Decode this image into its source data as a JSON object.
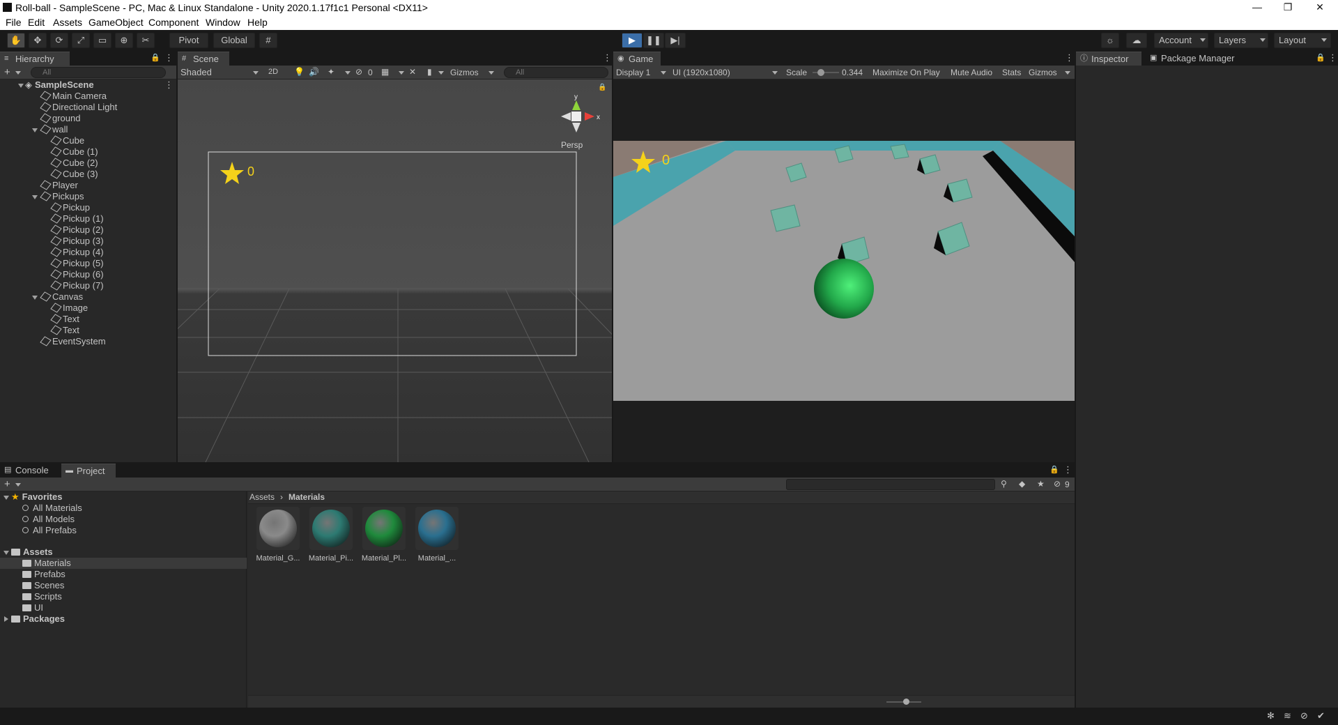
{
  "window": {
    "title": "Roll-ball - SampleScene - PC, Mac & Linux Standalone - Unity 2020.1.17f1c1 Personal <DX11>",
    "minimize": "—",
    "maximize": "❐",
    "close": "✕"
  },
  "menu": [
    "File",
    "Edit",
    "Assets",
    "GameObject",
    "Component",
    "Window",
    "Help"
  ],
  "toolbar": {
    "pivot": "Pivot",
    "global": "Global",
    "account": "Account",
    "layers": "Layers",
    "layout": "Layout"
  },
  "hierarchy": {
    "tab": "Hierarchy",
    "search_placeholder": "All",
    "scene": "SampleScene",
    "items": [
      {
        "label": "Main Camera",
        "level": 1
      },
      {
        "label": "Directional Light",
        "level": 1
      },
      {
        "label": "ground",
        "level": 1
      },
      {
        "label": "wall",
        "level": 1,
        "expanded": true
      },
      {
        "label": "Cube",
        "level": 2
      },
      {
        "label": "Cube (1)",
        "level": 2
      },
      {
        "label": "Cube (2)",
        "level": 2
      },
      {
        "label": "Cube (3)",
        "level": 2
      },
      {
        "label": "Player",
        "level": 1
      },
      {
        "label": "Pickups",
        "level": 1,
        "expanded": true
      },
      {
        "label": "Pickup",
        "level": 2
      },
      {
        "label": "Pickup (1)",
        "level": 2
      },
      {
        "label": "Pickup (2)",
        "level": 2
      },
      {
        "label": "Pickup (3)",
        "level": 2
      },
      {
        "label": "Pickup (4)",
        "level": 2
      },
      {
        "label": "Pickup (5)",
        "level": 2
      },
      {
        "label": "Pickup (6)",
        "level": 2
      },
      {
        "label": "Pickup (7)",
        "level": 2
      },
      {
        "label": "Canvas",
        "level": 1,
        "expanded": true
      },
      {
        "label": "Image",
        "level": 2
      },
      {
        "label": "Text",
        "level": 2
      },
      {
        "label": "Text",
        "level": 2
      },
      {
        "label": "EventSystem",
        "level": 1
      }
    ]
  },
  "scene": {
    "tab": "Scene",
    "shading": "Shaded",
    "mode2d": "2D",
    "hidden_count": "0",
    "gizmos": "Gizmos",
    "search_placeholder": "All",
    "persp": "Persp",
    "score": "0",
    "gizmo_y": "y",
    "gizmo_x": "x"
  },
  "game": {
    "tab": "Game",
    "display": "Display 1",
    "resolution": "UI (1920x1080)",
    "scale_label": "Scale",
    "scale": "0.344",
    "scale_level": 0.05,
    "maximize": "Maximize On Play",
    "mute": "Mute Audio",
    "stats": "Stats",
    "gizmos": "Gizmos",
    "score": "0"
  },
  "inspector": {
    "tab": "Inspector",
    "package_manager": "Package Manager"
  },
  "bottom": {
    "console": "Console",
    "project": "Project",
    "hidden_count": "9"
  },
  "project": {
    "favorites": "Favorites",
    "fav_items": [
      "All Materials",
      "All Models",
      "All Prefabs"
    ],
    "assets": "Assets",
    "asset_folders": [
      "Materials",
      "Prefabs",
      "Scenes",
      "Scripts",
      "UI"
    ],
    "packages": "Packages",
    "breadcrumb": [
      "Assets",
      "Materials"
    ],
    "materials": [
      {
        "label": "Material_G...",
        "color": "#8a8a8a"
      },
      {
        "label": "Material_Pi...",
        "color": "#2d7a72"
      },
      {
        "label": "Material_Pl...",
        "color": "#1f8a3c"
      },
      {
        "label": "Material_...",
        "color": "#2a6f8f"
      }
    ]
  },
  "colors": {
    "accent": "#3b7ed8",
    "play_active": "#3b6ea8",
    "star": "#f5d21a",
    "player": "#2fbf5b",
    "pickup": "#6fb5a2",
    "wall": "#4aa3ad"
  }
}
